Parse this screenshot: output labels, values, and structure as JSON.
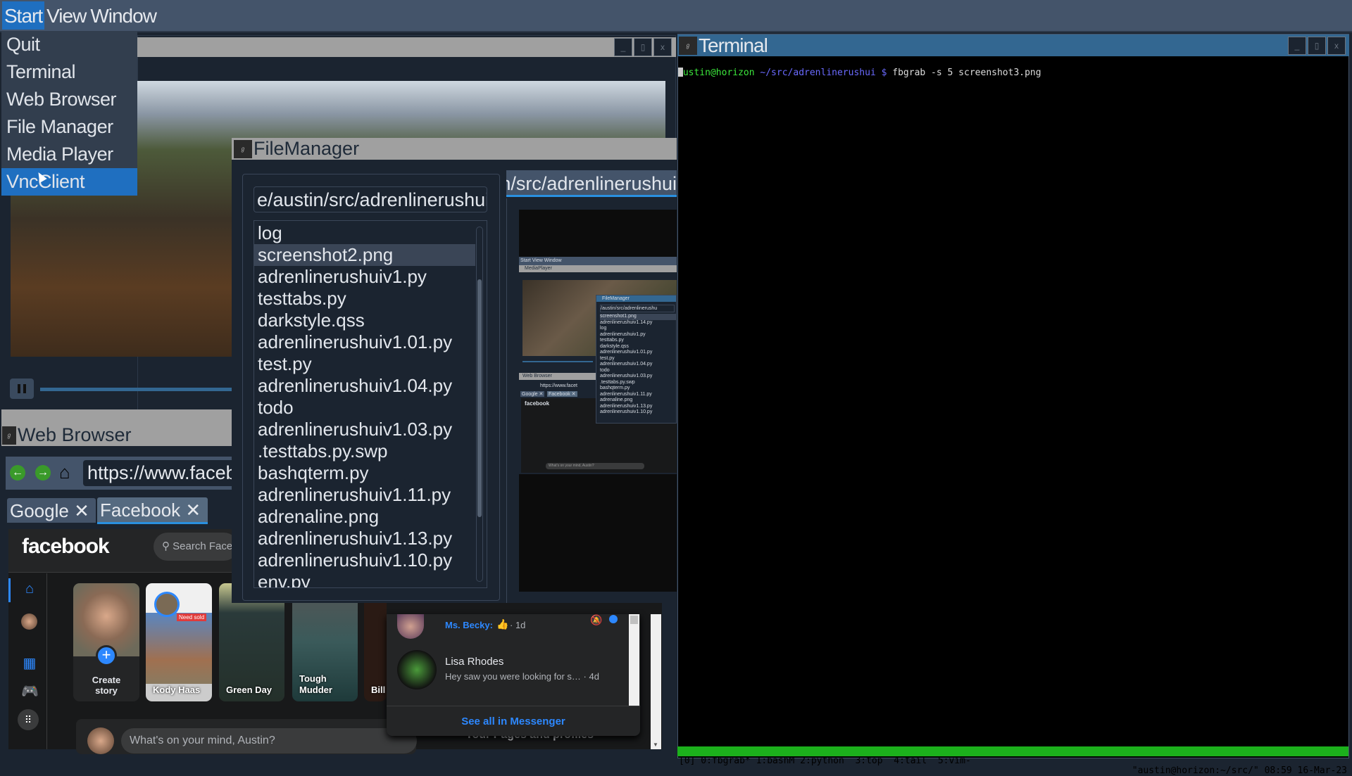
{
  "menubar": {
    "start": "Start",
    "view": "View",
    "window": "Window"
  },
  "start_menu": [
    "Quit",
    "Terminal",
    "Web Browser",
    "File Manager",
    "Media Player",
    "VncClient"
  ],
  "media_player": {
    "buttons": [
      "_",
      "▯",
      "x"
    ]
  },
  "web_browser": {
    "title": "Web Browser",
    "url": "https://www.facebook.com",
    "tabs": [
      {
        "label": "Google",
        "close": "✕"
      },
      {
        "label": "Facebook",
        "close": "✕"
      }
    ]
  },
  "facebook": {
    "logo": "facebook",
    "search_placeholder": "Search Facebook",
    "stories": [
      "Create story",
      "Kody Haas",
      "Green Day",
      "Tough Mudder",
      "Bill"
    ],
    "kody_badge": "Need sold",
    "composer": "What's on your mind, Austin?",
    "pages_heading": "Your Pages and profiles",
    "messenger": {
      "msg1_sender": "Ms. Becky:",
      "msg1_time": "· 1d",
      "msg2_name": "Lisa Rhodes",
      "msg2_text": "Hey saw you were looking for s…",
      "msg2_time": "· 4d",
      "see_all": "See all in Messenger"
    }
  },
  "file_manager": {
    "title": "FileManager",
    "path": "e/austin/src/adrenlinerushui",
    "preview_tab": "home/austin/src/adrenlinerushui",
    "files": [
      "log",
      "screenshot2.png",
      "adrenlinerushuiv1.py",
      "testtabs.py",
      "darkstyle.qss",
      "adrenlinerushuiv1.01.py",
      "test.py",
      "adrenlinerushuiv1.04.py",
      "todo",
      "adrenlinerushuiv1.03.py",
      ".testtabs.py.swp",
      "bashqterm.py",
      "adrenlinerushuiv1.11.py",
      "adrenaline.png",
      "adrenlinerushuiv1.13.py",
      "adrenlinerushuiv1.10.py",
      "env.py"
    ],
    "selected": "screenshot2.png"
  },
  "preview": {
    "menubar": "Start View Window",
    "media_title": "MediaPlayer",
    "fm_title": "FileManager",
    "fm_path": "/austin/src/adrenlinerushu",
    "fm_files": [
      "screenshot1.png",
      "adrenlinerushuiv1.14.py",
      "log",
      "adrenlinerushuiv1.py",
      "testtabs.py",
      "darkstyle.qss",
      "adrenlinerushuiv1.01.py",
      "test.py",
      "adrenlinerushuiv1.04.py",
      "todo",
      "adrenlinerushuiv1.03.py",
      ".testtabs.py.swp",
      "bashqterm.py",
      "adrenlinerushuiv1.11.py",
      "adrenaline.png",
      "adrenlinerushuiv1.13.py",
      "adrenlinerushuiv1.10.py"
    ],
    "browser_title": "Web Browser",
    "url": "https://www.facet",
    "tabs": [
      "Google ✕",
      "Facebook ✕"
    ],
    "fb_logo": "facebook",
    "composer": "What's on your mind, Austin?"
  },
  "terminal": {
    "title": "Terminal",
    "prompt_user": "austin@horizon",
    "prompt_path": "~/src/adrenlinerushui",
    "prompt_symbol": "$",
    "command": "fbgrab -s 5 screenshot3.png",
    "status_left": "[0] 0:fbgrab* 1:bashM 2:python  3:top  4:tail  5:vim-",
    "status_right": "\"austin@horizon:~/src/\" 08:59 16-Mar-23",
    "status_color": "#1cb01c"
  },
  "colors": {
    "accent": "#1f6fc0",
    "terminal_title": "#336791",
    "fb_blue": "#2d88ff"
  }
}
